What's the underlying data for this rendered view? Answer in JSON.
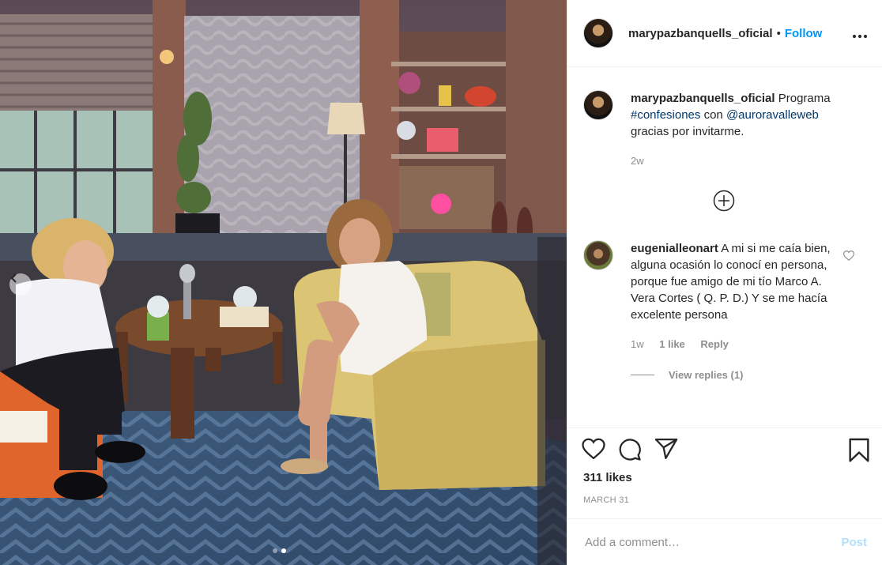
{
  "post": {
    "image_alt": "TV studio interview set with two women seated on armchairs",
    "carousel_total": 2,
    "carousel_active": 2
  },
  "header": {
    "username": "marypazbanquells_oficial",
    "separator": "•",
    "follow_label": "Follow",
    "more_label": "•••"
  },
  "caption": {
    "username": "marypazbanquells_oficial",
    "text_1": "Programa",
    "hashtag": "#confesiones",
    "text_2": "con",
    "mention": "@auroravalleweb",
    "text_3": "gracias por invitarme.",
    "time": "2w"
  },
  "comment": {
    "username": "eugenialleonart",
    "text": "A mi si me caía bien, alguna ocasión lo conocí en persona, porque fue amigo de mi tío Marco A. Vera Cortes ( Q. P. D.) Y se me hacía excelente persona",
    "time": "1w",
    "likes": "1 like",
    "reply_label": "Reply",
    "view_replies": "View replies (1)"
  },
  "actions": {
    "likes_text": "311 likes",
    "date": "MARCH 31"
  },
  "add_comment": {
    "placeholder": "Add a comment…",
    "post_label": "Post"
  },
  "colors": {
    "accent": "#0095f6",
    "post_disabled": "#b2dffc",
    "meta": "#8e8e8e"
  },
  "icons": [
    "chevron-left-icon",
    "more-icon",
    "add-circle-icon",
    "heart-icon",
    "comment-icon",
    "share-icon",
    "bookmark-icon"
  ]
}
